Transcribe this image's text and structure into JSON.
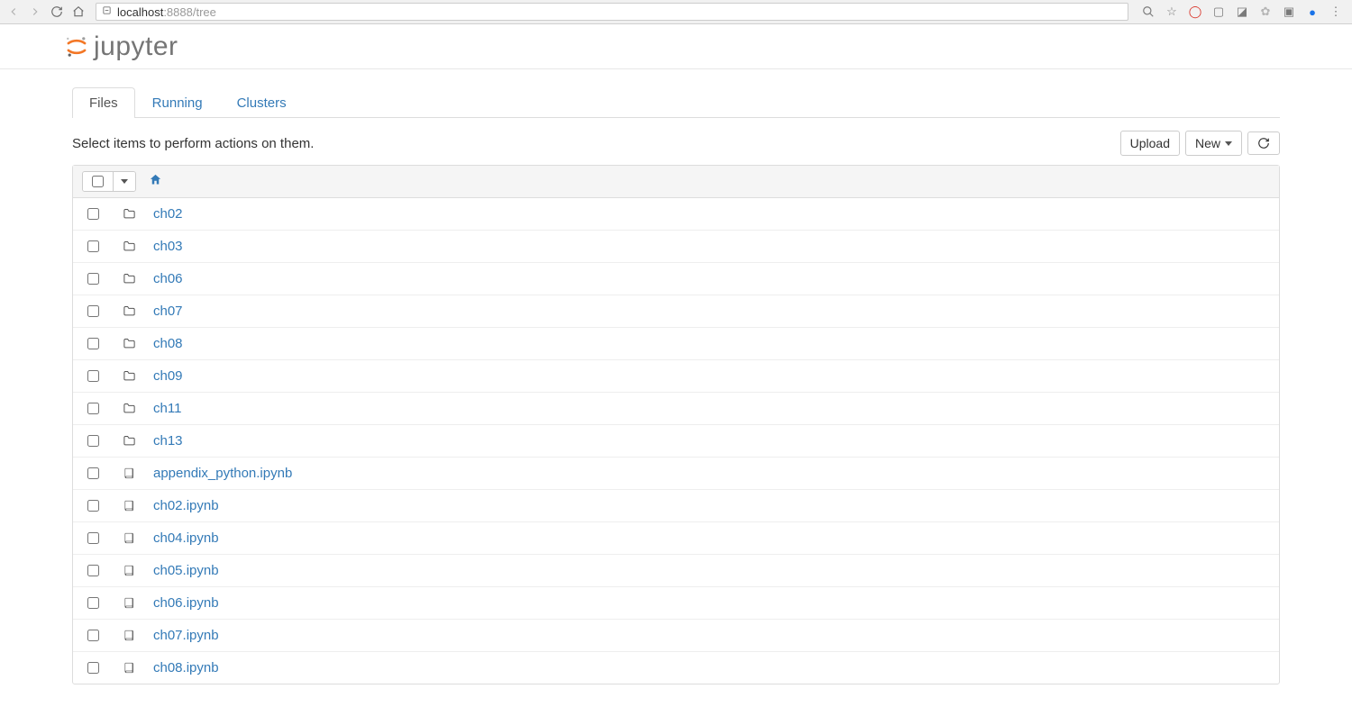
{
  "browser": {
    "url_host": "localhost",
    "url_rest": ":8888/tree"
  },
  "logo_text": "jupyter",
  "tabs": [
    {
      "label": "Files",
      "active": true
    },
    {
      "label": "Running",
      "active": false
    },
    {
      "label": "Clusters",
      "active": false
    }
  ],
  "hint": "Select items to perform actions on them.",
  "buttons": {
    "upload": "Upload",
    "new": "New"
  },
  "items": [
    {
      "type": "folder",
      "name": "ch02"
    },
    {
      "type": "folder",
      "name": "ch03"
    },
    {
      "type": "folder",
      "name": "ch06"
    },
    {
      "type": "folder",
      "name": "ch07"
    },
    {
      "type": "folder",
      "name": "ch08"
    },
    {
      "type": "folder",
      "name": "ch09"
    },
    {
      "type": "folder",
      "name": "ch11"
    },
    {
      "type": "folder",
      "name": "ch13"
    },
    {
      "type": "notebook",
      "name": "appendix_python.ipynb"
    },
    {
      "type": "notebook",
      "name": "ch02.ipynb"
    },
    {
      "type": "notebook",
      "name": "ch04.ipynb"
    },
    {
      "type": "notebook",
      "name": "ch05.ipynb"
    },
    {
      "type": "notebook",
      "name": "ch06.ipynb"
    },
    {
      "type": "notebook",
      "name": "ch07.ipynb"
    },
    {
      "type": "notebook",
      "name": "ch08.ipynb"
    }
  ]
}
